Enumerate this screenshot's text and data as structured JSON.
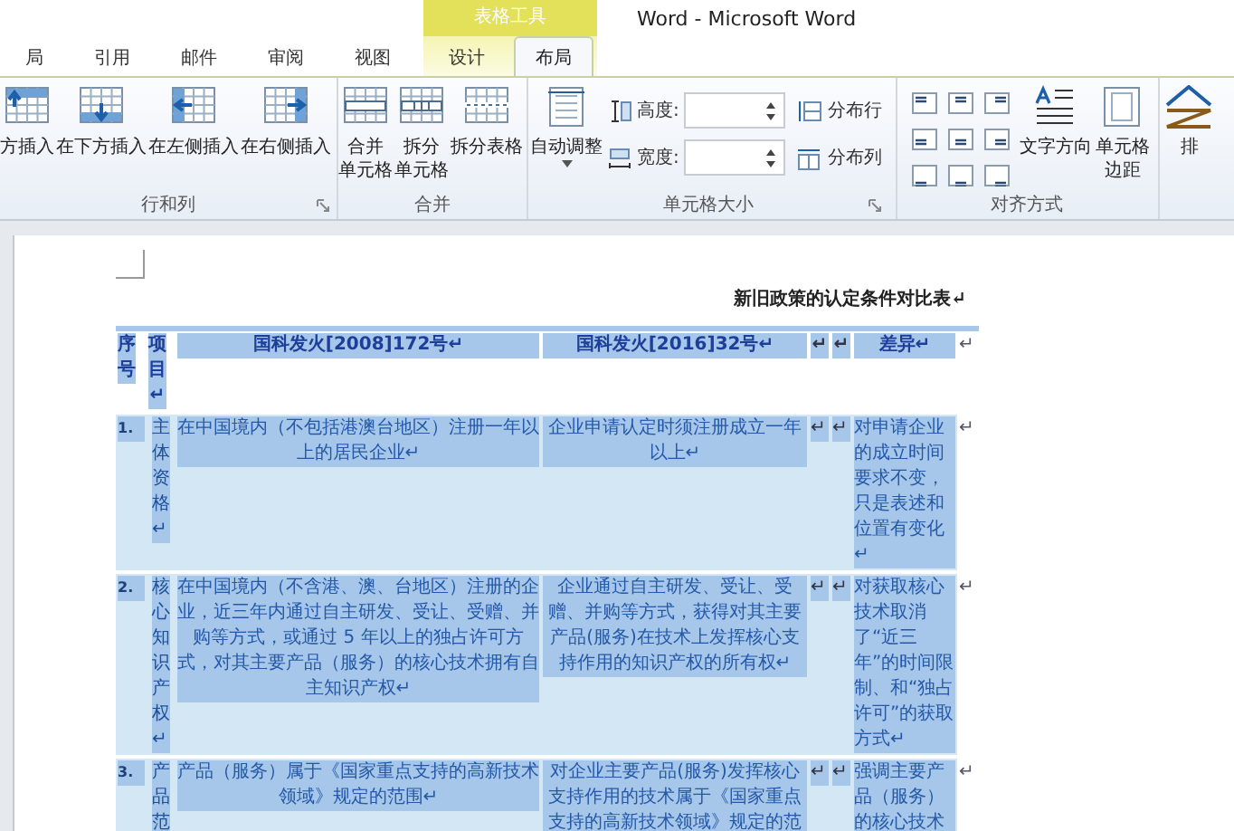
{
  "window": {
    "title": "Word - Microsoft Word"
  },
  "tabs": [
    {
      "label": "局",
      "selected": false
    },
    {
      "label": "引用",
      "selected": false
    },
    {
      "label": "邮件",
      "selected": false
    },
    {
      "label": "审阅",
      "selected": false
    },
    {
      "label": "视图",
      "selected": false
    }
  ],
  "contextual_tabs": {
    "title": "表格工具",
    "tabs": [
      {
        "label": "设计",
        "selected": false
      },
      {
        "label": "布局",
        "selected": true
      }
    ]
  },
  "ribbon": {
    "groups": [
      {
        "label": "行和列",
        "launcher": true,
        "items": [
          {
            "kind": "large",
            "label": "方插入"
          },
          {
            "kind": "large",
            "label": "在下方插入"
          },
          {
            "kind": "large",
            "label": "在左侧插入"
          },
          {
            "kind": "large",
            "label": "在右侧插入"
          }
        ]
      },
      {
        "label": "合并",
        "launcher": false,
        "items": [
          {
            "kind": "large",
            "lines": [
              "合并",
              "单元格"
            ]
          },
          {
            "kind": "large",
            "lines": [
              "拆分",
              "单元格"
            ]
          },
          {
            "kind": "large",
            "label": "拆分表格"
          }
        ]
      },
      {
        "label": "单元格大小",
        "launcher": true,
        "items": [
          {
            "kind": "dropdown",
            "label": "自动调整"
          },
          {
            "kind": "fields",
            "fields": [
              {
                "label": "高度:"
              },
              {
                "label": "宽度:"
              }
            ]
          },
          {
            "kind": "small",
            "buttons": [
              {
                "label": "分布行"
              },
              {
                "label": "分布列"
              }
            ]
          }
        ]
      },
      {
        "label": "对齐方式",
        "launcher": false,
        "items": [
          {
            "kind": "align"
          },
          {
            "kind": "large",
            "label": "文字方向"
          },
          {
            "kind": "large",
            "lines": [
              "单元格",
              "边距"
            ]
          }
        ]
      },
      {
        "launcher": false,
        "items": [
          {
            "kind": "large",
            "label": "排"
          }
        ]
      }
    ]
  },
  "document": {
    "caption": "新旧政策的认定条件对比表↵",
    "table": {
      "selected": true,
      "header": [
        "序号",
        "项目↵",
        "国科发火[2008]172号↵",
        "国科发火[2016]32号↵",
        "↵",
        "↵",
        "差异↵"
      ],
      "header_end": "↵",
      "rows": [
        {
          "cells": [
            "1.",
            "主体资格↵",
            "在中国境内（不包括港澳台地区）注册一年以上的居民企业↵",
            "企业申请认定时须注册成立一年以上↵",
            "↵",
            "↵",
            "对申请企业的成立时间要求不变，只是表述和位置有变化↵"
          ],
          "end": "↵"
        },
        {
          "cells": [
            "2.",
            "核心知识产权↵",
            "在中国境内（不含港、澳、台地区）注册的企业，近三年内通过自主研发、受让、受赠、并购等方式，或通过 5 年以上的独占许可方式，对其主要产品（服务）的核心技术拥有自主知识产权↵",
            "企业通过自主研发、受让、受赠、并购等方式，获得对其主要产品(服务)在技术上发挥核心支持作用的知识产权的所有权↵",
            "↵",
            "↵",
            "对获取核心技术取消了“近三年”的时间限制、和“独占许可”的获取方式↵"
          ],
          "end": "↵"
        },
        {
          "cells": [
            "3.",
            "产品范",
            "产品（服务）属于《国家重点支持的高新技术领域》规定的范围↵",
            "对企业主要产品(服务)发挥核心支持作用的技术属于《国家重点支持的高新技术领域》规定的范",
            "↵",
            "↵",
            "强调主要产品（服务）的核心技术"
          ],
          "end": "↵"
        }
      ]
    }
  }
}
